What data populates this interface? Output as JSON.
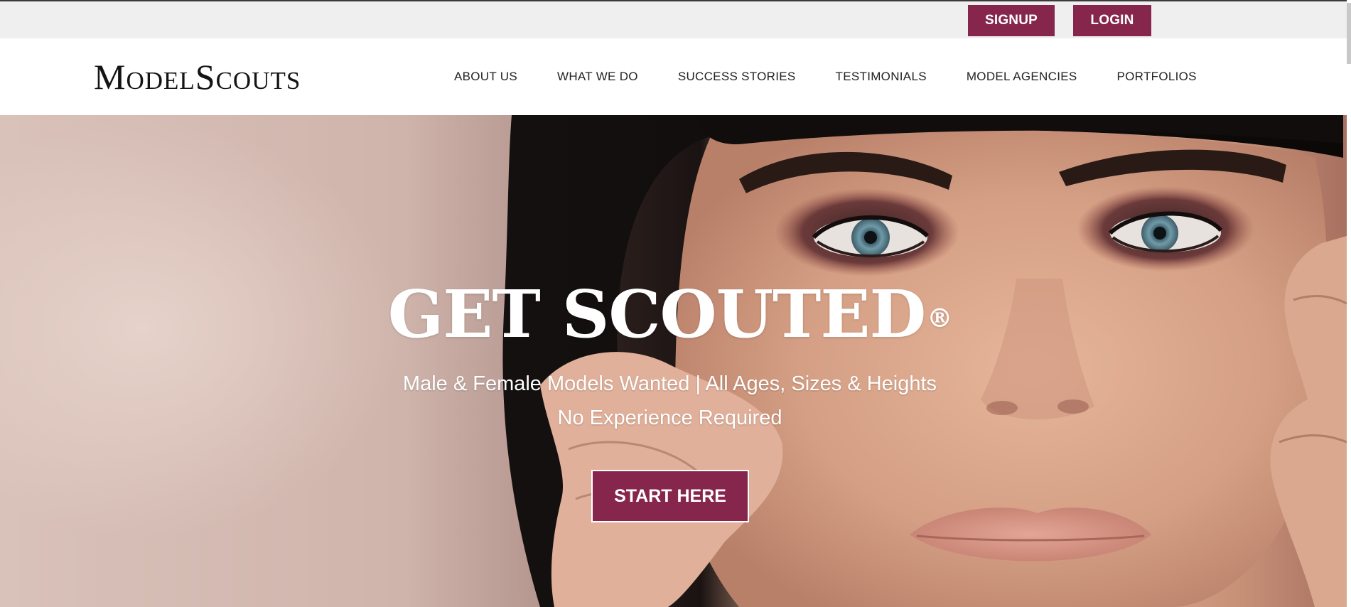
{
  "topbar": {
    "signup_label": "SIGNUP",
    "login_label": "LOGIN"
  },
  "header": {
    "logo_text": "ModelScouts",
    "nav": [
      {
        "label": "ABOUT US"
      },
      {
        "label": "WHAT WE DO"
      },
      {
        "label": "SUCCESS STORIES"
      },
      {
        "label": "TESTIMONIALS"
      },
      {
        "label": "MODEL AGENCIES"
      },
      {
        "label": "PORTFOLIOS"
      }
    ]
  },
  "hero": {
    "title": "GET SCOUTED",
    "title_mark": "®",
    "subtitle_line1": "Male & Female Models Wanted | All Ages, Sizes & Heights",
    "subtitle_line2": "No Experience Required",
    "cta_label": "START HERE"
  },
  "colors": {
    "brand": "#86264d",
    "topbar_bg": "#efefef",
    "header_bg": "#ffffff",
    "nav_text": "#222222"
  }
}
